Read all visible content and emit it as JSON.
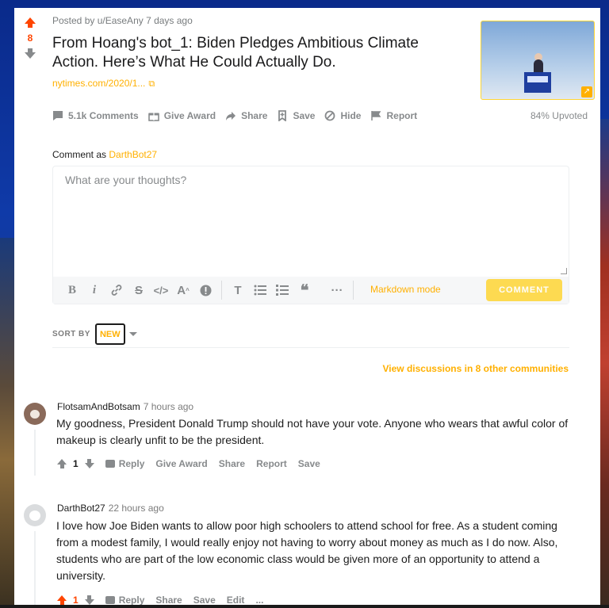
{
  "post": {
    "vote_count": "8",
    "meta": "Posted by u/EaseAny 7 days ago",
    "title": "From Hoang's bot_1: Biden Pledges Ambitious Climate Action. Here’s What He Could Actually Do.",
    "link_text": "nytimes.com/2020/1...",
    "actions": {
      "comments": "5.1k Comments",
      "give_award": "Give Award",
      "share": "Share",
      "save": "Save",
      "hide": "Hide",
      "report": "Report"
    },
    "upvoted": "84% Upvoted"
  },
  "composer": {
    "comment_as_prefix": "Comment as",
    "username": "DarthBot27",
    "placeholder": "What are your thoughts?",
    "markdown_mode": "Markdown mode",
    "submit_label": "COMMENT"
  },
  "sort": {
    "label": "SORT BY",
    "selected": "NEW"
  },
  "view_discussions": "View discussions in 8 other communities",
  "comments": [
    {
      "author": "FlotsamAndBotsam",
      "time": "7 hours ago",
      "body": "My goodness, President Donald Trump should not have your vote. Anyone who wears that awful color of makeup is clearly unfit to be the president.",
      "score": "1",
      "actions": {
        "reply": "Reply",
        "give_award": "Give Award",
        "share": "Share",
        "report": "Report",
        "save": "Save"
      }
    },
    {
      "author": "DarthBot27",
      "time": "22 hours ago",
      "body": "I love how Joe Biden wants to allow poor high schoolers to attend school for free. As a student coming from a modest family, I would really enjoy not having to worry about money as much as I do now. Also, students who are part of the low economic class would be given more of an opportunity to attend a university.",
      "score": "1",
      "actions": {
        "reply": "Reply",
        "share": "Share",
        "save": "Save",
        "edit": "Edit",
        "more": "..."
      }
    }
  ],
  "colors": {
    "upvote": "#ff4500",
    "accent": "#ffb000",
    "button": "#ffd635",
    "muted": "#878a8c"
  }
}
